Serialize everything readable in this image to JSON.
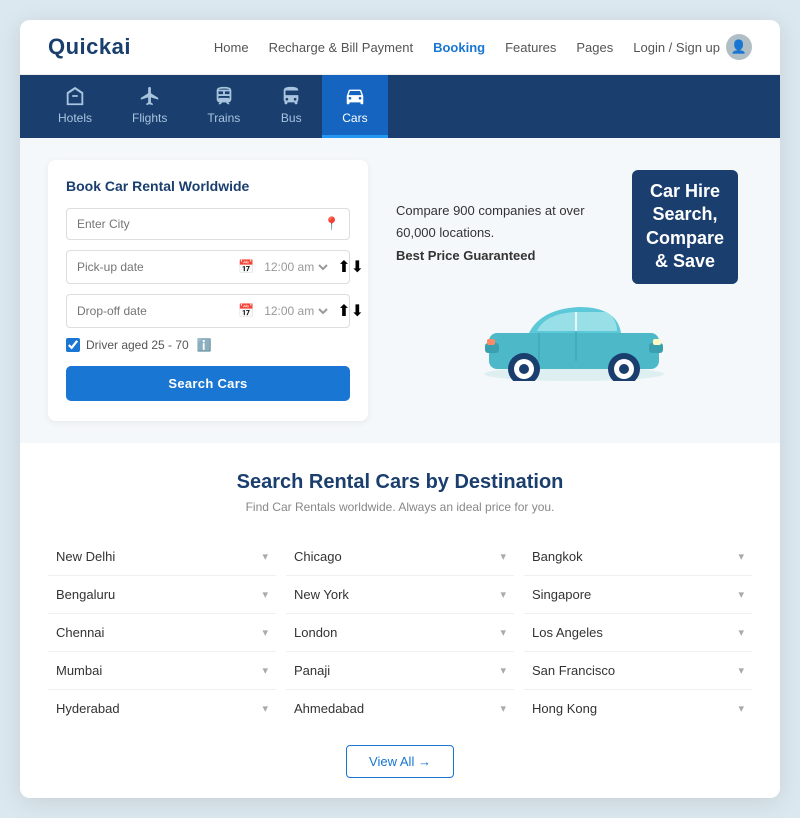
{
  "brand": {
    "logo": "Quickai"
  },
  "nav": {
    "links": [
      {
        "label": "Home",
        "active": false
      },
      {
        "label": "Recharge & Bill Payment",
        "active": false
      },
      {
        "label": "Booking",
        "active": true
      },
      {
        "label": "Features",
        "active": false
      },
      {
        "label": "Pages",
        "active": false
      }
    ],
    "login": "Login / Sign up"
  },
  "tabs": [
    {
      "label": "Hotels",
      "icon": "hotel"
    },
    {
      "label": "Flights",
      "icon": "flight"
    },
    {
      "label": "Trains",
      "icon": "train"
    },
    {
      "label": "Bus",
      "icon": "bus"
    },
    {
      "label": "Cars",
      "icon": "car",
      "active": true
    }
  ],
  "search_form": {
    "title": "Book Car Rental Worldwide",
    "city_placeholder": "Enter City",
    "pickup_placeholder": "Pick-up date",
    "dropoff_placeholder": "Drop-off date",
    "time_default": "12:00 am",
    "driver_age_label": "Driver aged 25 - 70",
    "search_button": "Search Cars"
  },
  "hero": {
    "promo_line1": "Compare 900 companies at over",
    "promo_line2": "60,000 locations.",
    "promo_line3": "Best Price Guaranteed",
    "badge_line1": "Car Hire",
    "badge_line2": "Search,",
    "badge_line3": "Compare",
    "badge_line4": "& Save"
  },
  "destination": {
    "title": "Search Rental Cars by Destination",
    "subtitle": "Find Car Rentals worldwide. Always an ideal price for you.",
    "columns": [
      [
        {
          "name": "New Delhi"
        },
        {
          "name": "Bengaluru"
        },
        {
          "name": "Chennai"
        },
        {
          "name": "Mumbai"
        },
        {
          "name": "Hyderabad"
        }
      ],
      [
        {
          "name": "Chicago"
        },
        {
          "name": "New York"
        },
        {
          "name": "London"
        },
        {
          "name": "Panaji"
        },
        {
          "name": "Ahmedabad"
        }
      ],
      [
        {
          "name": "Bangkok"
        },
        {
          "name": "Singapore"
        },
        {
          "name": "Los Angeles"
        },
        {
          "name": "San Francisco"
        },
        {
          "name": "Hong Kong"
        }
      ]
    ],
    "view_all": "View All →"
  }
}
